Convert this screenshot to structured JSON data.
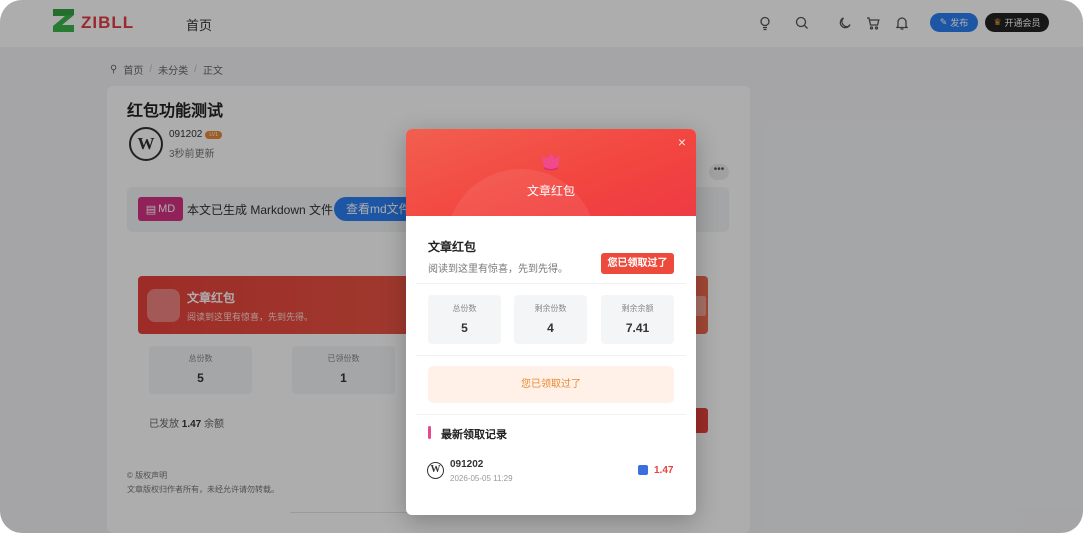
{
  "header": {
    "logo_text": "ZIBLL",
    "nav_home": "首页",
    "publish_label": "发布",
    "vip_label": "开通会员",
    "icons": [
      "bulb-icon",
      "search-icon",
      "moon-icon",
      "cart-icon",
      "bell-icon"
    ]
  },
  "breadcrumb": {
    "items": [
      "首页",
      "未分类",
      "正文"
    ]
  },
  "post": {
    "title": "红包功能测试",
    "author_name": "091202",
    "author_level": "LV1",
    "updated": "3秒前更新",
    "more": "•••"
  },
  "markdown": {
    "badge": "MD",
    "text": "本文已生成 Markdown 文件",
    "button": "查看md文件"
  },
  "red_packet_card": {
    "title": "文章红包",
    "subtitle": "阅读到这里有惊喜，先到先得。",
    "stats": [
      {
        "label": "总份数",
        "value": "5"
      },
      {
        "label": "已领份数",
        "value": "1"
      }
    ],
    "sent_prefix": "已发放",
    "sent_amount": "1.47",
    "sent_suffix": "余额"
  },
  "copyright": {
    "title": "© 版权声明",
    "text": "文章版权归作者所有，未经允许请勿转载。"
  },
  "modal": {
    "header_title": "文章红包",
    "close": "×",
    "title": "文章红包",
    "subtitle": "阅读到这里有惊喜，先到先得。",
    "claimed_tag": "您已领取过了",
    "stats": [
      {
        "label": "总份数",
        "value": "5"
      },
      {
        "label": "剩余份数",
        "value": "4"
      },
      {
        "label": "剩余余额",
        "value": "7.41"
      }
    ],
    "claim_button": "您已领取过了",
    "records_title": "最新领取记录",
    "records": [
      {
        "name": "091202",
        "time": "2026-05-05 11:29",
        "amount": "1.47"
      }
    ]
  },
  "colors": {
    "brand_red": "#e8413b",
    "accent_blue": "#2d7ff5",
    "md_pink": "#d63384",
    "claim_orange": "#e8872e"
  }
}
